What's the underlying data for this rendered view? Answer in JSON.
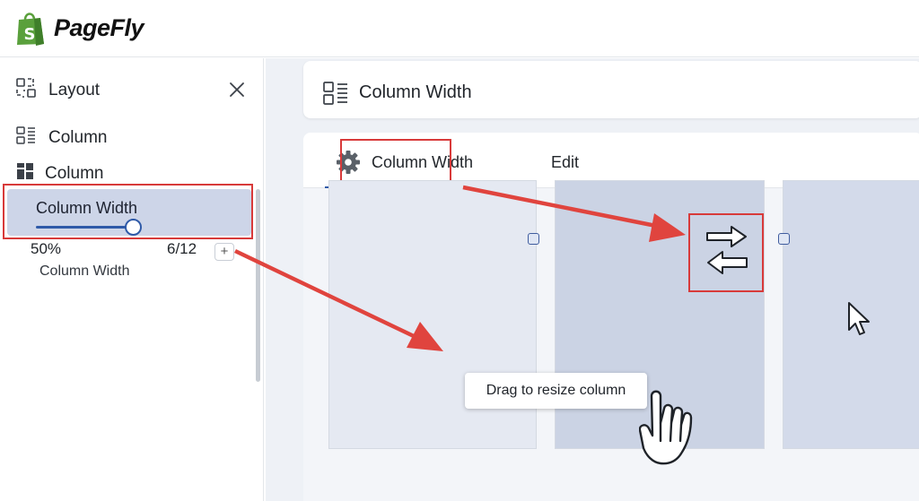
{
  "app": {
    "name": "PageFly"
  },
  "sidebar": {
    "title": "Layout",
    "items": [
      {
        "label": "Column",
        "icon": "column-list-icon"
      },
      {
        "label": "Column",
        "icon": "column-grid-icon"
      }
    ],
    "selected": {
      "label": "Column Width",
      "slider_value_percent": 50,
      "value_percent_label": "50%",
      "value_fraction_label": "6/12",
      "plus_label": "+",
      "sub_label": "Column Width"
    }
  },
  "main": {
    "title": "Column Width",
    "tabs": [
      {
        "label": "Column Width",
        "active": true,
        "icon": "gear-icon"
      },
      {
        "label": "Edit",
        "active": false
      }
    ]
  },
  "canvas": {
    "tooltip": "Drag to resize column",
    "columns": [
      "column-1",
      "column-2",
      "column-3"
    ]
  },
  "colors": {
    "accent": "#2f5aa8",
    "highlight": "#cdd5e8",
    "annotation_red": "#d83a3a",
    "brand_green": "#5aa03c"
  }
}
